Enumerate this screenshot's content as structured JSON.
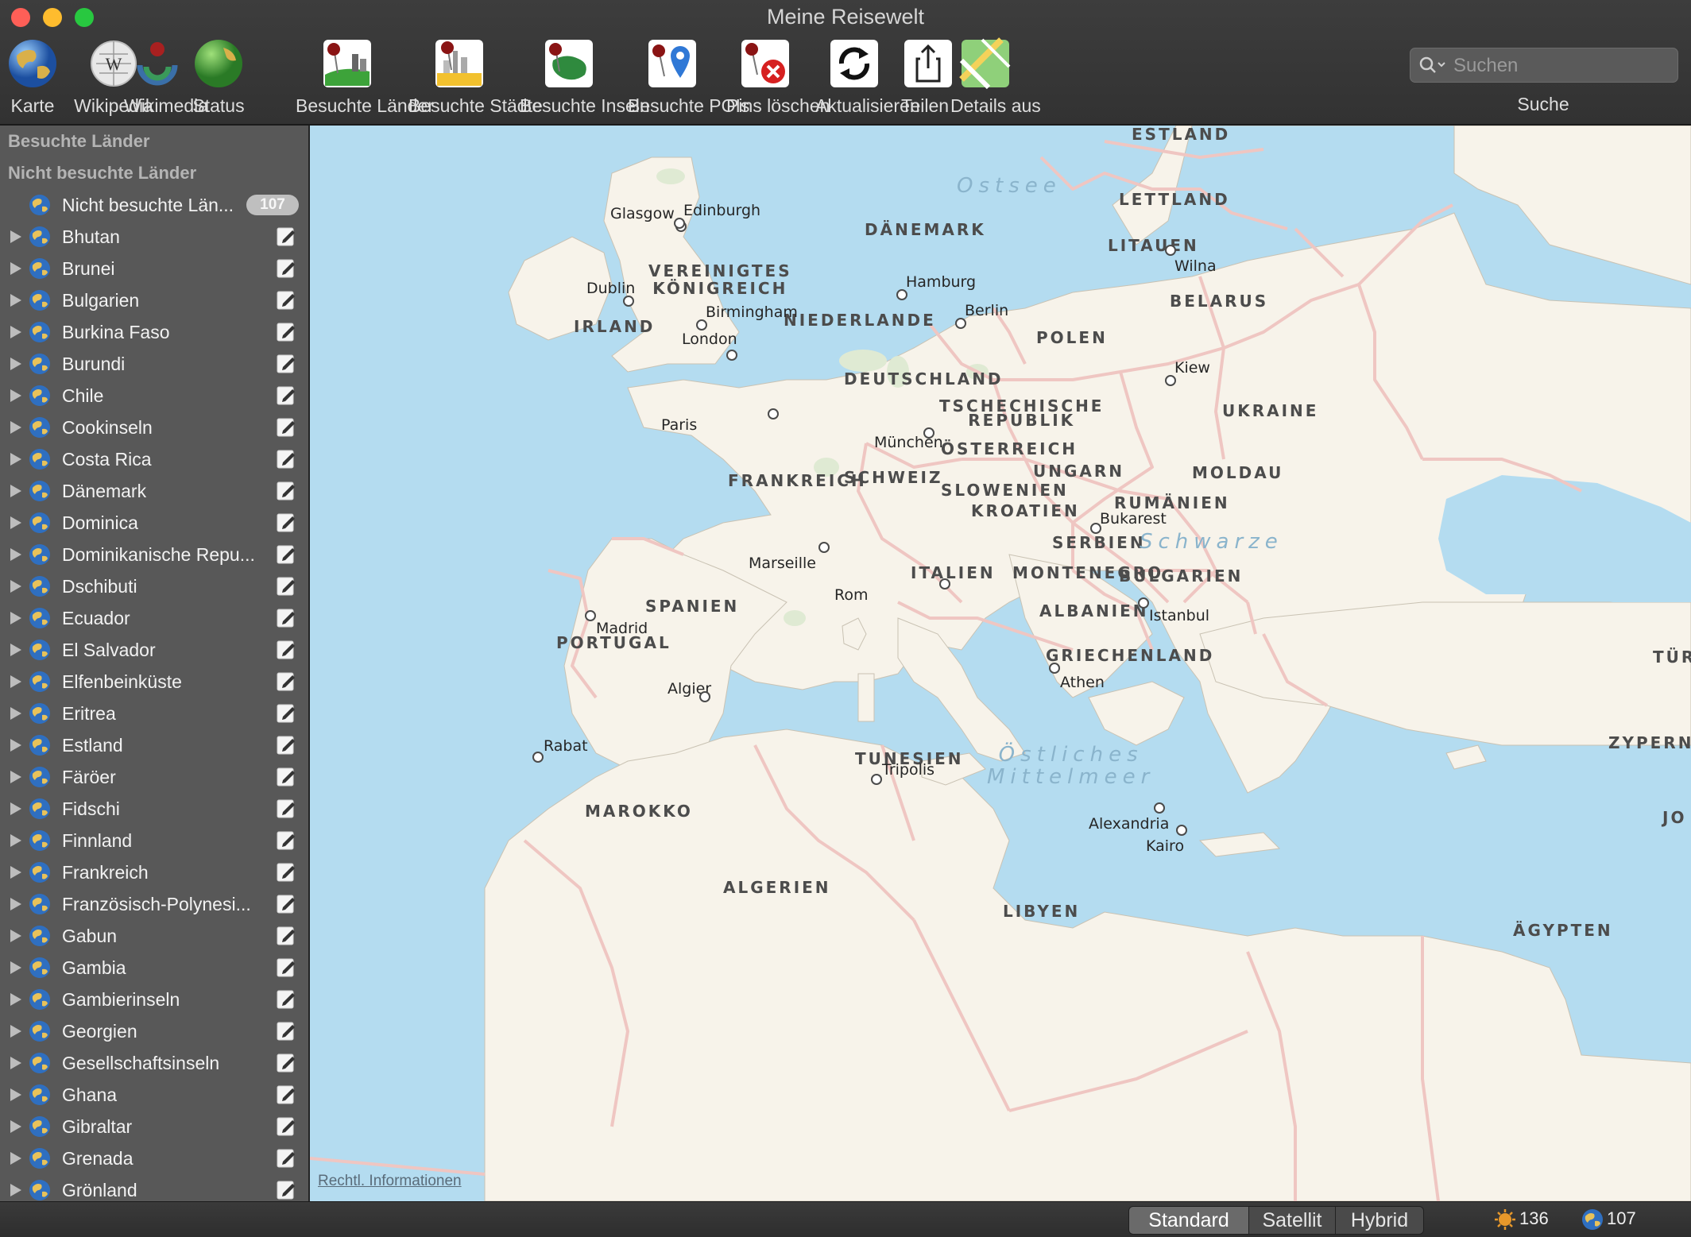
{
  "window": {
    "title": "Meine Reisewelt"
  },
  "toolbar": {
    "left_items": [
      {
        "label": "Karte",
        "icon": "globe-icon"
      },
      {
        "label": "Wikipedia",
        "icon": "wikipedia-icon"
      },
      {
        "label": "Wikimedia",
        "icon": "wikimedia-icon"
      },
      {
        "label": "Status",
        "icon": "status-globe-icon"
      }
    ],
    "main_items": [
      {
        "label": "Besuchte Länder",
        "icon": "visited-countries-icon"
      },
      {
        "label": "Besuchte Städte",
        "icon": "visited-cities-icon"
      },
      {
        "label": "Besuchte Inseln",
        "icon": "visited-islands-icon"
      },
      {
        "label": "Besuchte POIs",
        "icon": "visited-pois-icon"
      },
      {
        "label": "Pins löschen",
        "icon": "delete-pins-icon"
      },
      {
        "label": "Aktualisieren",
        "icon": "refresh-icon"
      },
      {
        "label": "Teilen",
        "icon": "share-icon"
      },
      {
        "label": "Details aus",
        "icon": "details-icon"
      }
    ],
    "search": {
      "placeholder": "Suchen",
      "label": "Suche"
    }
  },
  "sidebar": {
    "section_visited": "Besuchte Länder",
    "section_unvisited": "Nicht besuchte Länder",
    "group": {
      "label": "Nicht besuchte Län...",
      "count": "107"
    },
    "countries": [
      "Bhutan",
      "Brunei",
      "Bulgarien",
      "Burkina Faso",
      "Burundi",
      "Chile",
      "Cookinseln",
      "Costa Rica",
      "Dänemark",
      "Dominica",
      "Dominikanische Repu...",
      "Dschibuti",
      "Ecuador",
      "El Salvador",
      "Elfenbeinküste",
      "Eritrea",
      "Estland",
      "Färöer",
      "Fidschi",
      "Finnland",
      "Frankreich",
      "Französisch-Polynesi...",
      "Gabun",
      "Gambia",
      "Gambierinseln",
      "Georgien",
      "Gesellschaftsinseln",
      "Ghana",
      "Gibraltar",
      "Grenada",
      "Grönland"
    ]
  },
  "map": {
    "legal": "Rechtl. Informationen",
    "countries": [
      {
        "t": "ESTLAND"
      },
      {
        "t": "LETTLAND"
      },
      {
        "t": "DÄNEMARK"
      },
      {
        "t": "LITAUEN"
      },
      {
        "t": "VEREINIGTES\nKÖNIGREICH"
      },
      {
        "t": "BELARUS"
      },
      {
        "t": "IRLAND"
      },
      {
        "t": "NIEDERLANDE"
      },
      {
        "t": "POLEN"
      },
      {
        "t": "DEUTSCHLAND"
      },
      {
        "t": "TSCHECHISCHE\nREPUBLIK"
      },
      {
        "t": "UKRAINE"
      },
      {
        "t": "ÖSTERREICH"
      },
      {
        "t": "UNGARN"
      },
      {
        "t": "MOLDAU"
      },
      {
        "t": "FRANKREICH"
      },
      {
        "t": "SCHWEIZ"
      },
      {
        "t": "SLOWENIEN"
      },
      {
        "t": "KROATIEN"
      },
      {
        "t": "RUMÄNIEN"
      },
      {
        "t": "SERBIEN"
      },
      {
        "t": "ITALIEN"
      },
      {
        "t": "MONTENEGRO"
      },
      {
        "t": "BULGARIEN"
      },
      {
        "t": "SPANIEN"
      },
      {
        "t": "ALBANIEN"
      },
      {
        "t": "PORTUGAL"
      },
      {
        "t": "GRIECHENLAND"
      },
      {
        "t": "TÜR"
      },
      {
        "t": "ZYPERN"
      },
      {
        "t": "TUNESIEN"
      },
      {
        "t": "MAROKKO"
      },
      {
        "t": "JO"
      },
      {
        "t": "ALGERIEN"
      },
      {
        "t": "LIBYEN"
      },
      {
        "t": "ÄGYPTEN"
      }
    ],
    "cities": [
      {
        "t": "Glasgow"
      },
      {
        "t": "Edinburgh"
      },
      {
        "t": "Wilna"
      },
      {
        "t": "Hamburg"
      },
      {
        "t": "Dublin"
      },
      {
        "t": "Birmingham"
      },
      {
        "t": "Berlin"
      },
      {
        "t": "London"
      },
      {
        "t": "Kiew"
      },
      {
        "t": "Paris"
      },
      {
        "t": "München"
      },
      {
        "t": "Bukarest"
      },
      {
        "t": "Marseille"
      },
      {
        "t": "Rom"
      },
      {
        "t": "Istanbul"
      },
      {
        "t": "Madrid"
      },
      {
        "t": "Athen"
      },
      {
        "t": "Algier"
      },
      {
        "t": "Rabat"
      },
      {
        "t": "Tripolis"
      },
      {
        "t": "Alexandria"
      },
      {
        "t": "Kairo"
      }
    ],
    "seas": [
      {
        "t": "Ostsee"
      },
      {
        "t": "Schwarze"
      },
      {
        "t": "Östliches\nMittelmeer"
      }
    ]
  },
  "statusbar": {
    "map_types": [
      "Standard",
      "Satellit",
      "Hybrid"
    ],
    "active_map_type": "Standard",
    "visited_count": "136",
    "unvisited_count": "107"
  }
}
